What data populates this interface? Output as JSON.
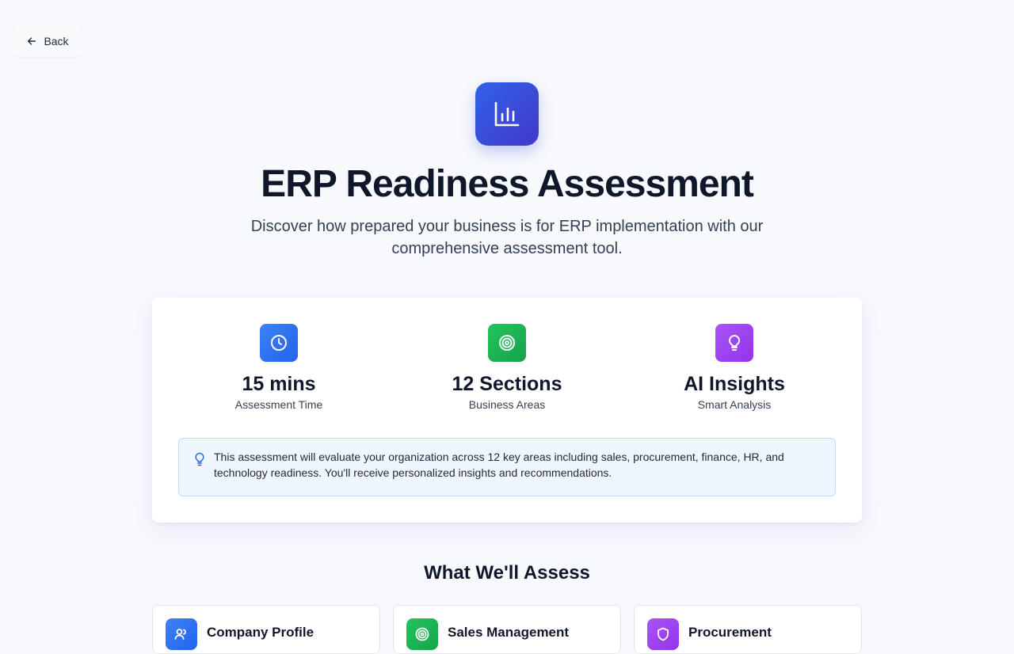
{
  "nav": {
    "back_label": "Back"
  },
  "hero": {
    "icon": "bar-chart-icon",
    "title": "ERP Readiness Assessment",
    "subtitle": "Discover how prepared your business is for ERP implementation with our comprehensive assessment tool."
  },
  "stats": [
    {
      "icon": "clock-icon",
      "value": "15 mins",
      "label": "Assessment Time",
      "color": "#2f6df0"
    },
    {
      "icon": "target-icon",
      "value": "12 Sections",
      "label": "Business Areas",
      "color": "#16a34a"
    },
    {
      "icon": "lightbulb-icon",
      "value": "AI Insights",
      "label": "Smart Analysis",
      "color": "#9333ea"
    }
  ],
  "info": {
    "icon": "lightbulb-icon",
    "text": "This assessment will evaluate your organization across 12 key areas including sales, procurement, finance, HR, and technology readiness. You'll receive personalized insights and recommendations."
  },
  "assess": {
    "heading": "What We'll Assess",
    "cards": [
      {
        "icon": "users-icon",
        "title": "Company Profile",
        "color": "#2f6df0"
      },
      {
        "icon": "target-icon",
        "title": "Sales Management",
        "color": "#16a34a"
      },
      {
        "icon": "shield-icon",
        "title": "Procurement",
        "color": "#9333ea"
      }
    ]
  },
  "colors": {
    "background": "#f7f9fc",
    "accent_blue": "#2f62e8",
    "accent_indigo": "#4338ca",
    "info_bg": "#eff6ff",
    "info_border": "#bfdbfe"
  }
}
